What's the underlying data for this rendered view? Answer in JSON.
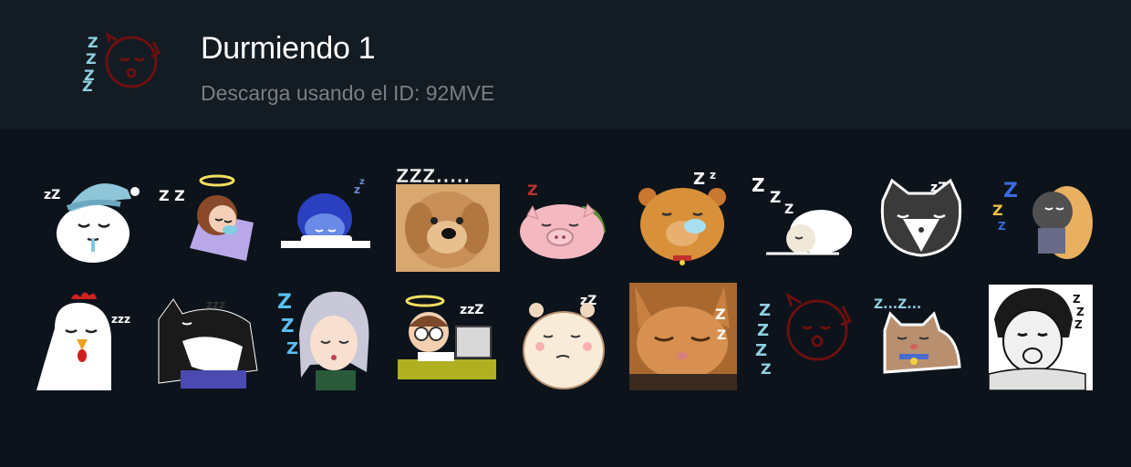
{
  "pack": {
    "title": "Durmiendo 1",
    "subtitle": "Descarga usando el ID: 92MVE",
    "icon": "sleeping-face-zzz-icon"
  },
  "stickers": [
    {
      "name": "sticker-snowman-sleeping-nightcap"
    },
    {
      "name": "sticker-angel-girl-sleeping-pillow"
    },
    {
      "name": "sticker-blue-hair-girl-sleeping"
    },
    {
      "name": "sticker-dog-photo-zzz"
    },
    {
      "name": "sticker-pig-sleeping"
    },
    {
      "name": "sticker-bear-sleeping-bubble"
    },
    {
      "name": "sticker-sheep-sleeping"
    },
    {
      "name": "sticker-cat-face-sleeping"
    },
    {
      "name": "sticker-kid-sleeping-zzz"
    },
    {
      "name": "sticker-chicken-sleeping"
    },
    {
      "name": "sticker-tuxedo-cat-sleeping"
    },
    {
      "name": "sticker-anime-girl-sleeping"
    },
    {
      "name": "sticker-angel-boy-computer-sleeping"
    },
    {
      "name": "sticker-hamster-sleeping"
    },
    {
      "name": "sticker-orange-cat-photo-sleeping"
    },
    {
      "name": "sticker-sleeping-face-zzz"
    },
    {
      "name": "sticker-tabby-cat-sleeping-zzz"
    },
    {
      "name": "sticker-manga-man-sleeping"
    }
  ]
}
